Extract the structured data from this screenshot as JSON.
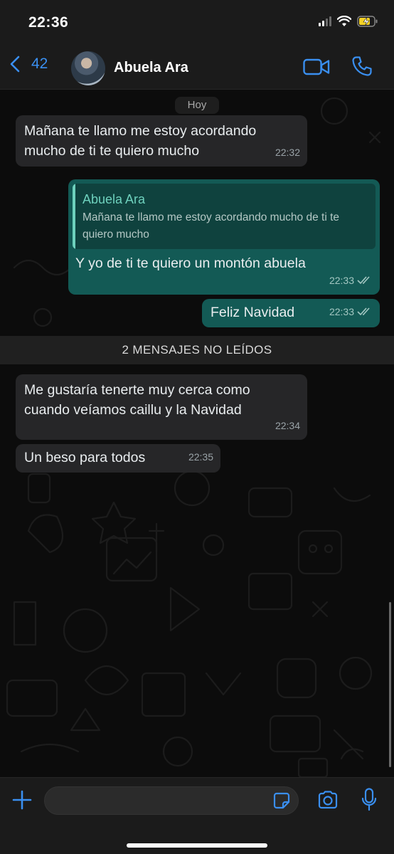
{
  "status_bar": {
    "time": "22:36",
    "icons": [
      "signal-icon",
      "wifi-icon",
      "battery-charging-icon"
    ]
  },
  "header": {
    "back_count": "42",
    "contact_name": "Abuela Ara",
    "icons": [
      "chevron-left-icon",
      "video-call-icon",
      "phone-call-icon"
    ]
  },
  "chat": {
    "date_label": "Hoy",
    "unread_label": "2 MENSAJES NO LEÍDOS",
    "messages": [
      {
        "direction": "in",
        "text": "Mañana te llamo me estoy acordando mucho de ti te quiero mucho",
        "time": "22:32"
      },
      {
        "direction": "out",
        "quote_author": "Abuela Ara",
        "quote_text": "Mañana te llamo me estoy acordando mucho de ti te quiero mucho",
        "text": "Y yo de ti te quiero un montón abuela",
        "time": "22:33",
        "read": true
      },
      {
        "direction": "out",
        "text": "Feliz Navidad",
        "time": "22:33",
        "read": true
      },
      {
        "direction": "in",
        "text": "Me gustaría tenerte muy cerca como cuando veíamos caillu y la Navidad",
        "time": "22:34"
      },
      {
        "direction": "in",
        "text": "Un beso para todos",
        "time": "22:35"
      }
    ]
  },
  "input_bar": {
    "placeholder": "",
    "icons": [
      "plus-icon",
      "sticker-icon",
      "camera-icon",
      "microphone-icon"
    ]
  },
  "colors": {
    "accent": "#3a8ff0",
    "outgoing_bubble": "#135a55",
    "incoming_bubble": "#262628",
    "quote_name": "#6ed1bd"
  }
}
